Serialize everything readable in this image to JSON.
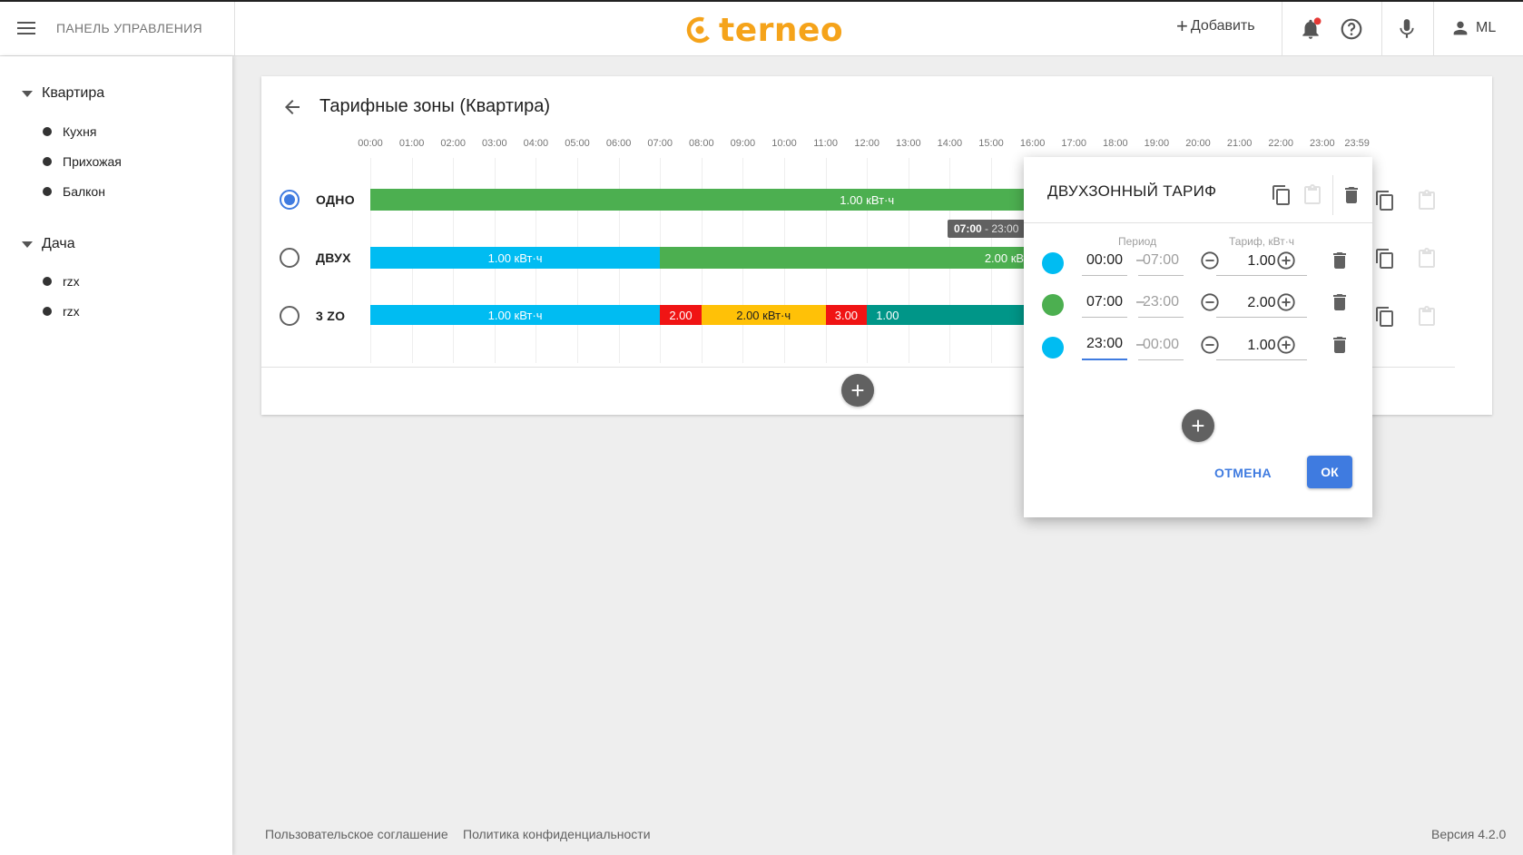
{
  "header": {
    "title": "ПАНЕЛЬ УПРАВЛЕНИЯ",
    "logo_text": "terneo",
    "add_label": "Добавить",
    "user_initials": "ML",
    "brand_color": "#f5a31a"
  },
  "sidebar": {
    "groups": [
      {
        "label": "Квартира",
        "items": [
          "Кухня",
          "Прихожая",
          "Балкон"
        ]
      },
      {
        "label": "Дача",
        "items": [
          "rzx",
          "rzx"
        ]
      }
    ]
  },
  "page": {
    "title": "Тарифные зоны (Квартира)",
    "hours": [
      "00:00",
      "01:00",
      "02:00",
      "03:00",
      "04:00",
      "05:00",
      "06:00",
      "07:00",
      "08:00",
      "09:00",
      "10:00",
      "11:00",
      "12:00",
      "13:00",
      "14:00",
      "15:00",
      "16:00",
      "17:00",
      "18:00",
      "19:00",
      "20:00",
      "21:00",
      "22:00",
      "23:00",
      "23:59"
    ],
    "tooltip": {
      "start": "07:00",
      "end": "23:00"
    },
    "rows": [
      {
        "name": "ОДНО",
        "selected": true,
        "segments": [
          {
            "start": 0,
            "end": 24,
            "label": "1.00 кВт·ч",
            "color": "#4caf50"
          }
        ]
      },
      {
        "name": "ДВУХ",
        "selected": false,
        "segments": [
          {
            "start": 0,
            "end": 7,
            "label": "1.00 кВт·ч",
            "color": "#00bcf2"
          },
          {
            "start": 7,
            "end": 24,
            "label": "2.00 кВт·ч",
            "color": "#4caf50"
          }
        ]
      },
      {
        "name": "3 ZO",
        "selected": false,
        "segments": [
          {
            "start": 0,
            "end": 7,
            "label": "1.00 кВт·ч",
            "color": "#00bcf2"
          },
          {
            "start": 7,
            "end": 8,
            "label": "2.00",
            "color": "#f01414"
          },
          {
            "start": 8,
            "end": 11,
            "label": "2.00 кВт·ч",
            "color": "#ffc107"
          },
          {
            "start": 11,
            "end": 12,
            "label": "3.00",
            "color": "#f01414"
          },
          {
            "start": 12,
            "end": 24,
            "label": "1.00",
            "color": "#009688"
          }
        ]
      }
    ]
  },
  "dialog": {
    "title": "ДВУХЗОННЫЙ ТАРИФ",
    "period_header": "Период",
    "rate_header": "Тариф, кВт·ч",
    "zones": [
      {
        "color": "#00bcf2",
        "from": "00:00",
        "to": "07:00",
        "rate": "1.00"
      },
      {
        "color": "#4caf50",
        "from": "07:00",
        "to": "23:00",
        "rate": "2.00"
      },
      {
        "color": "#00bcf2",
        "from": "23:00",
        "to": "00:00",
        "rate": "1.00"
      }
    ],
    "cancel_label": "ОТМЕНА",
    "ok_label": "ОК",
    "accent_color": "#3f7be0"
  },
  "footer": {
    "links": [
      "Пользовательское соглашение",
      "Политика конфиденциальности"
    ],
    "version": "Версия 4.2.0"
  }
}
